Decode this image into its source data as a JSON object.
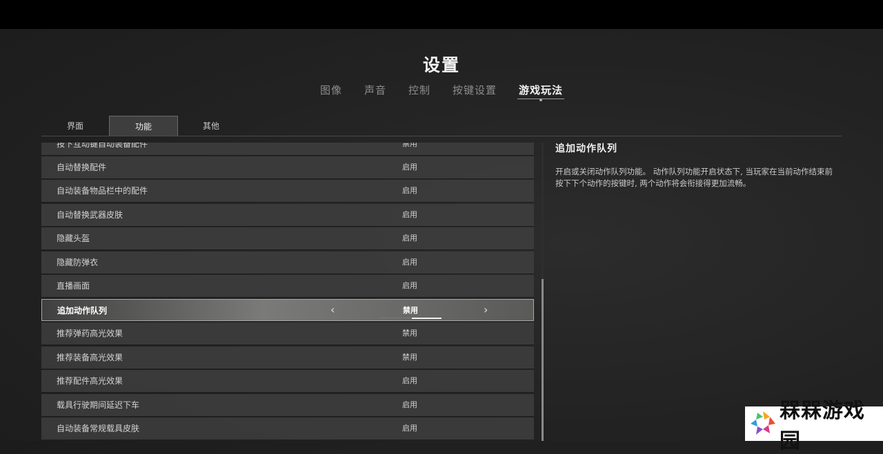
{
  "page_title": "设置",
  "main_tabs": [
    {
      "label": "图像"
    },
    {
      "label": "声音"
    },
    {
      "label": "控制"
    },
    {
      "label": "按键设置"
    },
    {
      "label": "游戏玩法",
      "active": true
    }
  ],
  "sub_tabs": [
    {
      "label": "界面"
    },
    {
      "label": "功能",
      "active": true
    },
    {
      "label": "其他"
    }
  ],
  "settings": [
    {
      "label": "按下互动键自动装备配件",
      "value": "禁用"
    },
    {
      "label": "自动替换配件",
      "value": "启用"
    },
    {
      "label": "自动装备物品栏中的配件",
      "value": "启用"
    },
    {
      "label": "自动替换武器皮肤",
      "value": "启用"
    },
    {
      "label": "隐藏头盔",
      "value": "启用"
    },
    {
      "label": "隐藏防弹衣",
      "value": "启用"
    },
    {
      "label": "直播画面",
      "value": "启用"
    },
    {
      "label": "追加动作队列",
      "value": "禁用",
      "selected": true
    },
    {
      "label": "推荐弹药高光效果",
      "value": "禁用"
    },
    {
      "label": "推荐装备高光效果",
      "value": "禁用"
    },
    {
      "label": "推荐配件高光效果",
      "value": "启用"
    },
    {
      "label": "载具行驶期间延迟下车",
      "value": "启用"
    },
    {
      "label": "自动装备常规载具皮肤",
      "value": "启用"
    }
  ],
  "selected_arrows": {
    "left": "‹",
    "right": "›"
  },
  "description": {
    "title": "追加动作队列",
    "text": "开启或关闭动作队列功能。 动作队列功能开启状态下, 当玩家在当前动作结束前按下下个动作的按键时, 两个动作将会衔接得更加流畅。"
  },
  "watermark": {
    "text": "槑槑游戏园"
  }
}
